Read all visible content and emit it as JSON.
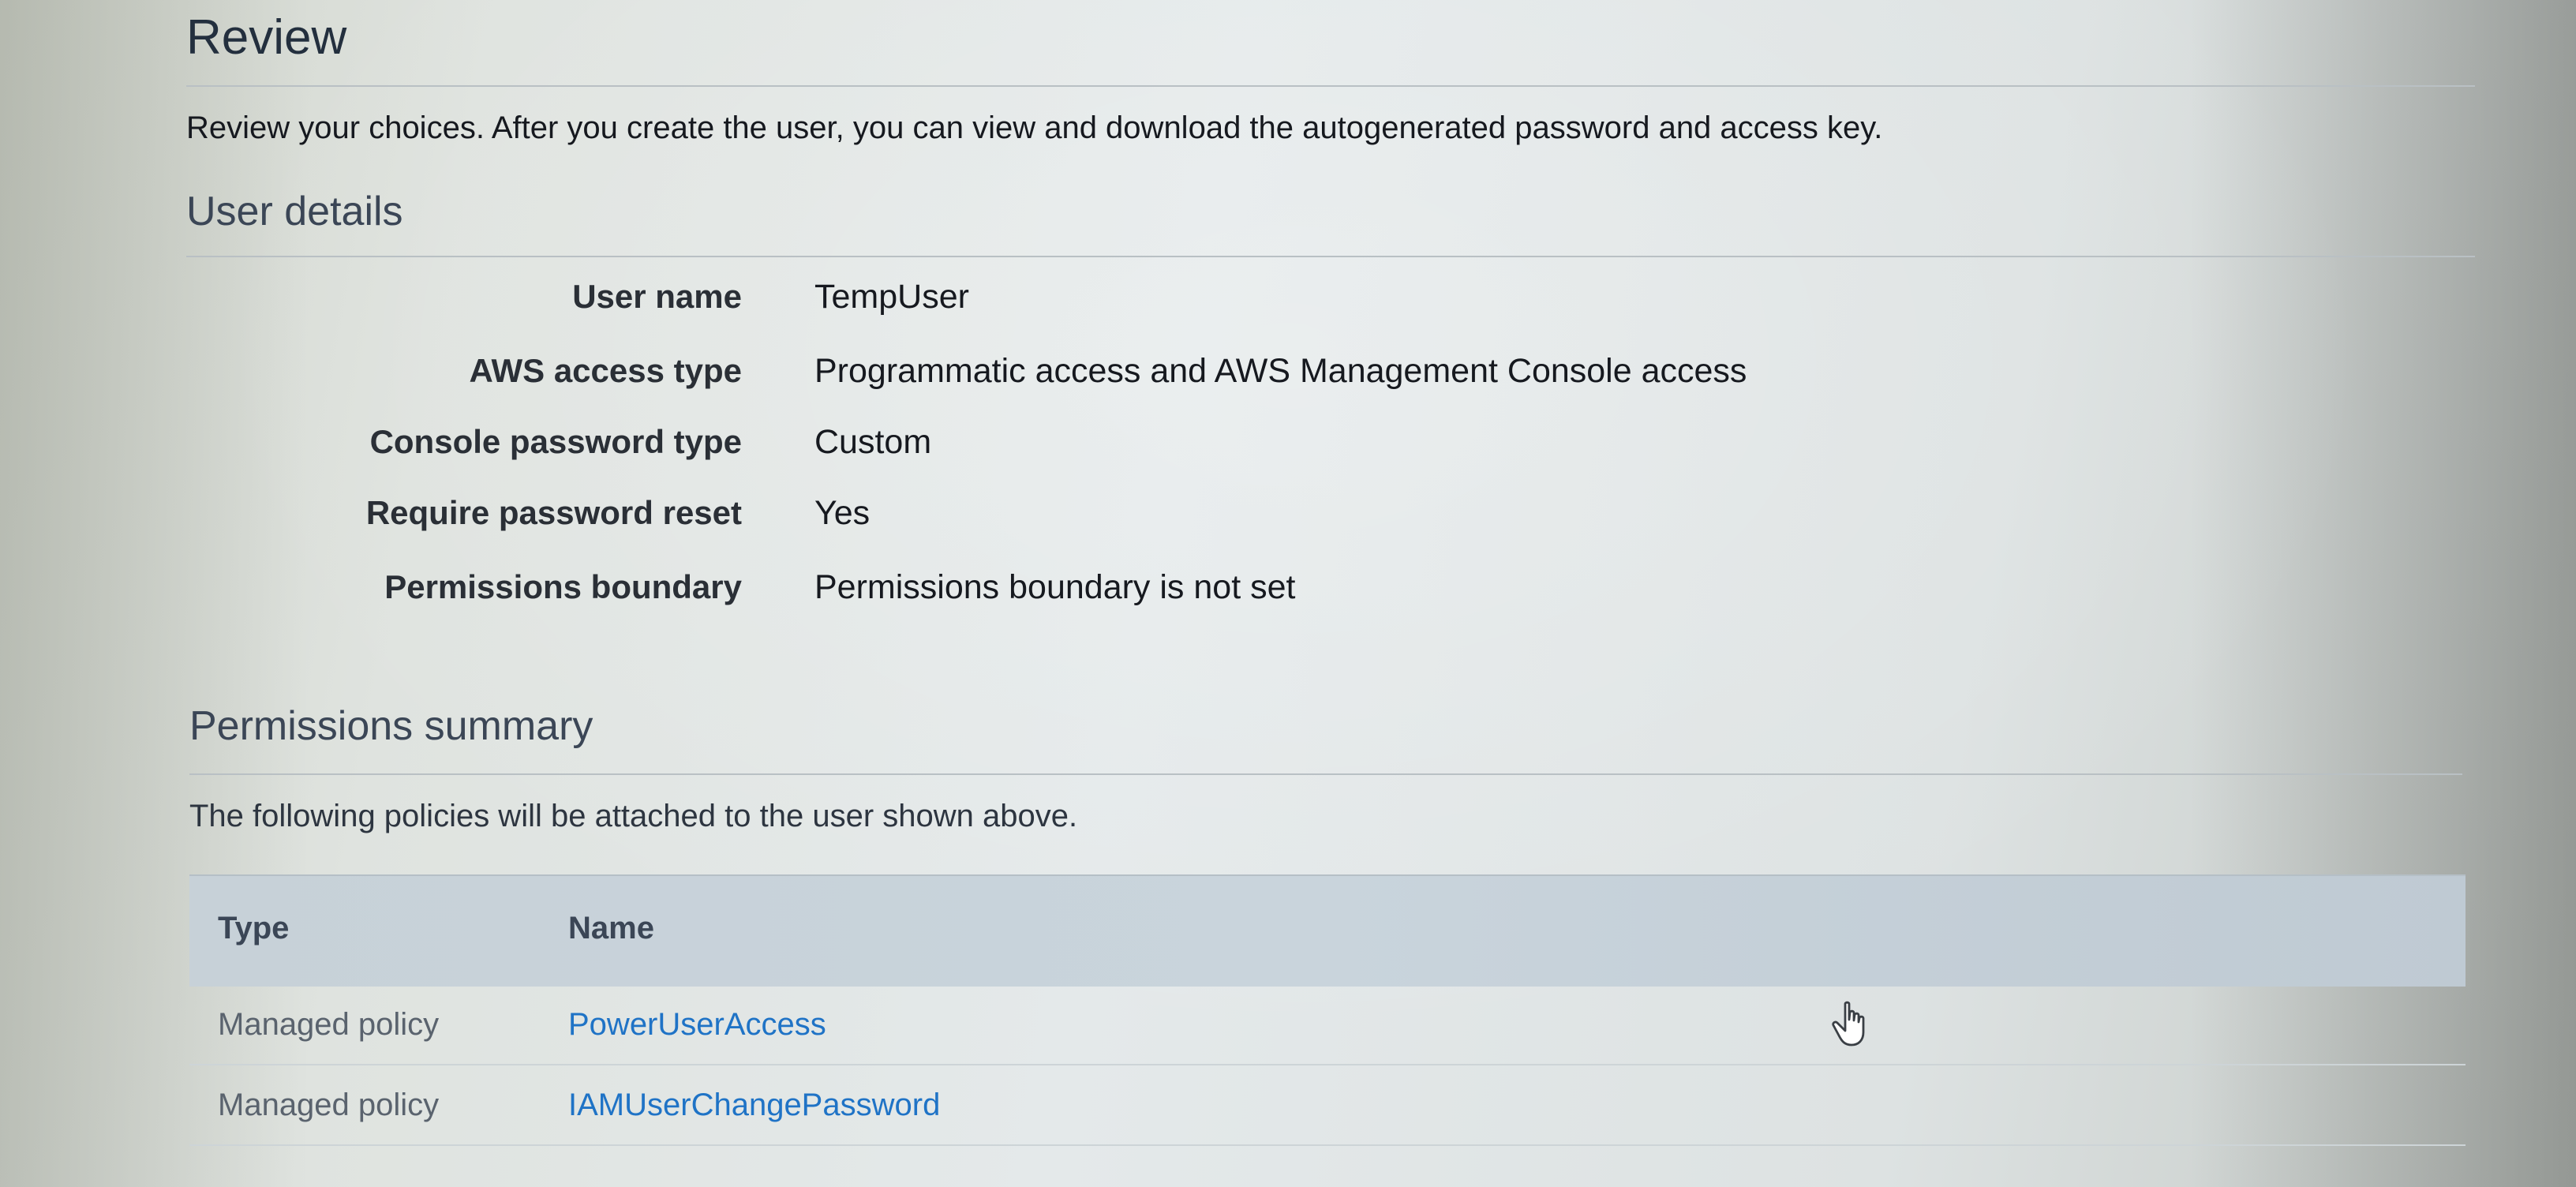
{
  "review": {
    "title": "Review",
    "intro": "Review your choices. After you create the user, you can view and download the autogenerated password and access key."
  },
  "user_details": {
    "heading": "User details",
    "rows": [
      {
        "label": "User name",
        "value": "TempUser"
      },
      {
        "label": "AWS access type",
        "value": "Programmatic access and AWS Management Console access"
      },
      {
        "label": "Console password type",
        "value": "Custom"
      },
      {
        "label": "Require password reset",
        "value": "Yes"
      },
      {
        "label": "Permissions boundary",
        "value": "Permissions boundary is not set"
      }
    ]
  },
  "permissions_summary": {
    "heading": "Permissions summary",
    "note": "The following policies will be attached to the user shown above.",
    "columns": {
      "type": "Type",
      "name": "Name"
    },
    "rows": [
      {
        "type": "Managed policy",
        "name": "PowerUserAccess"
      },
      {
        "type": "Managed policy",
        "name": "IAMUserChangePassword"
      }
    ]
  },
  "colors": {
    "link": "#1f73c6",
    "table_header": "#c9d4dc",
    "heading": "#232f3e"
  },
  "icons": {
    "cursor": "hand-pointer-icon"
  }
}
